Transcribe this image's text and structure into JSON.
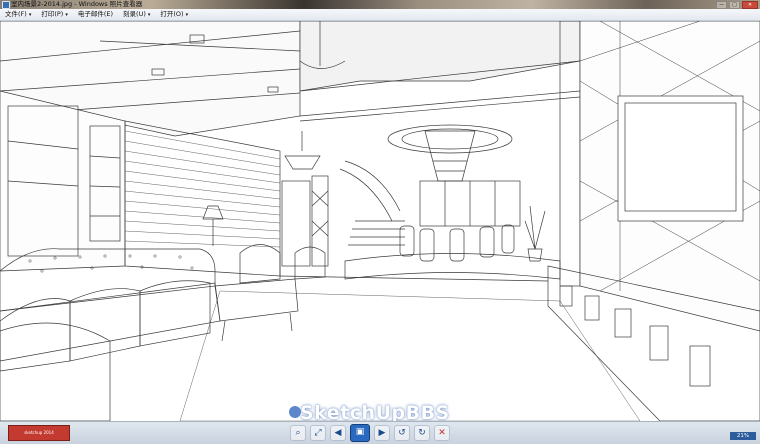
{
  "window": {
    "title": "室内场景2-2014.jpg - Windows 照片查看器",
    "minimize": "—",
    "maximize": "□",
    "close": "✕"
  },
  "menu": {
    "items": [
      {
        "label": "文件(F)",
        "caret": "▾"
      },
      {
        "label": "打印(P)",
        "caret": "▾"
      },
      {
        "label": "电子邮件(E)",
        "caret": ""
      },
      {
        "label": "刻录(U)",
        "caret": "▾"
      },
      {
        "label": "打开(O)",
        "caret": "▾"
      }
    ]
  },
  "viewer": {
    "image_subject": "living-room-line-rendering"
  },
  "toolbar": {
    "left_thumbnail_text": "sketchup 2014",
    "buttons": [
      {
        "name": "zoom-button",
        "glyph": "⌕"
      },
      {
        "name": "fit-button",
        "glyph": "⤢"
      },
      {
        "name": "previous-button",
        "glyph": "◀"
      },
      {
        "name": "slideshow-button",
        "glyph": "▣"
      },
      {
        "name": "next-button",
        "glyph": "▶"
      },
      {
        "name": "rotate-left-button",
        "glyph": "↺"
      },
      {
        "name": "rotate-right-button",
        "glyph": "↻"
      },
      {
        "name": "delete-button",
        "glyph": "✕"
      }
    ],
    "zoom_level": "21%"
  },
  "watermark": {
    "text": "SketchUpBBS"
  },
  "colors": {
    "accent": "#2a69c0",
    "close": "#c94a3a",
    "delete": "#c42d21"
  }
}
